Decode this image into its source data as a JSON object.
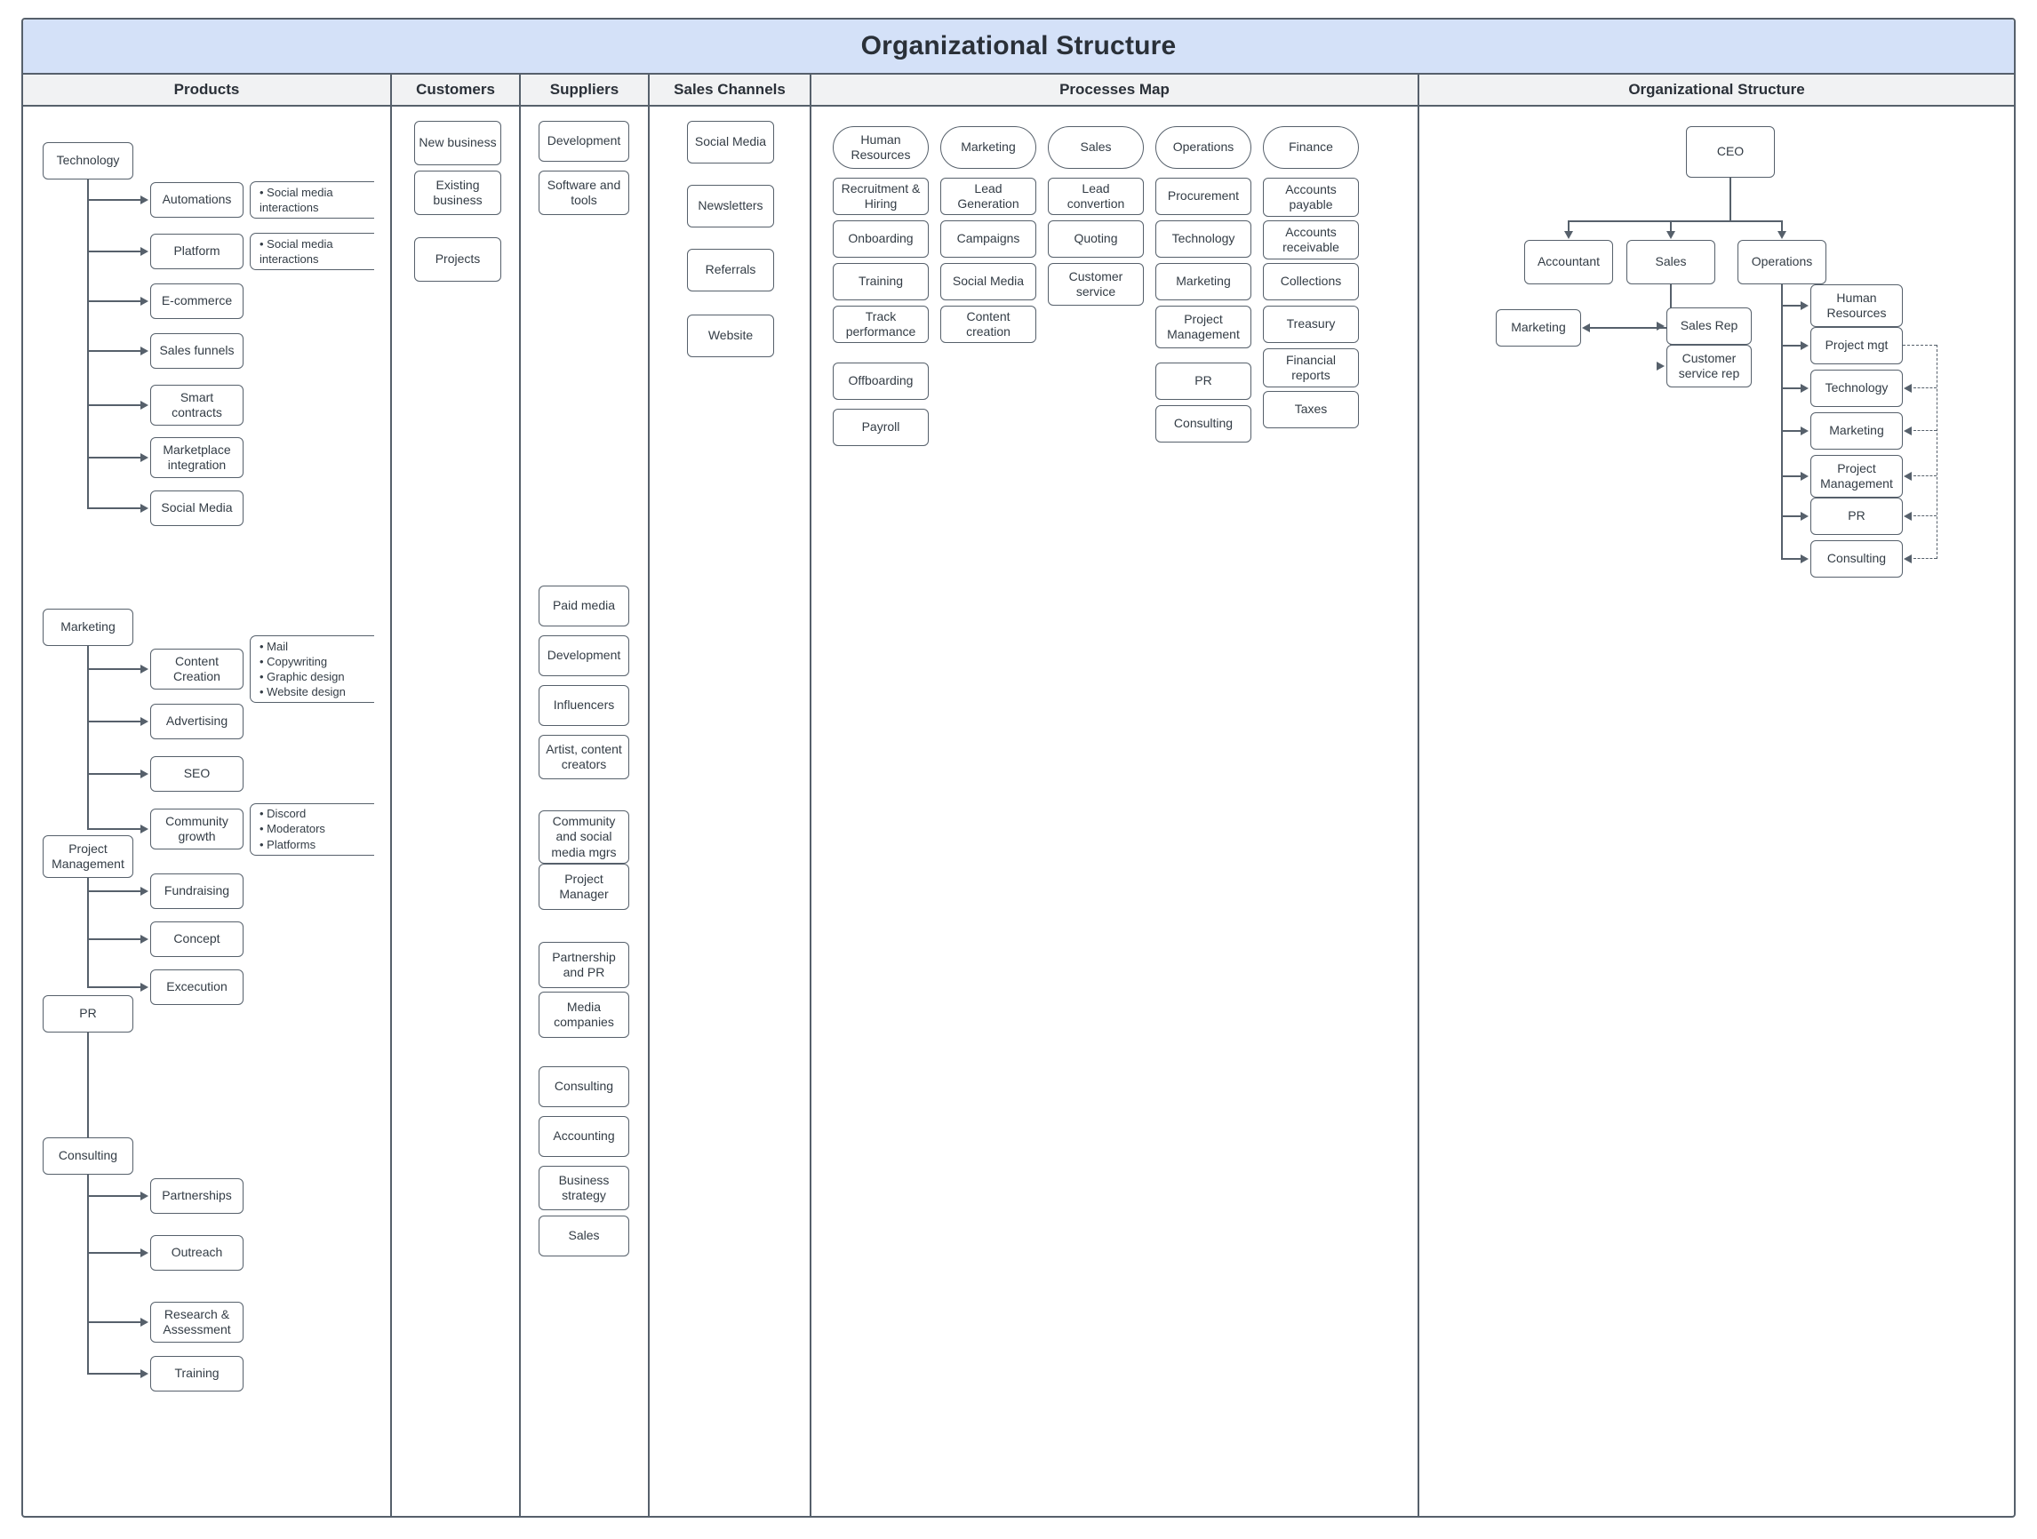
{
  "title": "Organizational Structure",
  "columns": [
    {
      "id": "products",
      "label": "Products"
    },
    {
      "id": "customers",
      "label": "Customers"
    },
    {
      "id": "suppliers",
      "label": "Suppliers"
    },
    {
      "id": "channels",
      "label": "Sales Channels"
    },
    {
      "id": "processes",
      "label": "Processes Map"
    },
    {
      "id": "org",
      "label": "Organizational Structure"
    }
  ],
  "products": {
    "groups": [
      {
        "parent": "Technology",
        "children": [
          {
            "label": "Automations",
            "notes": [
              "• Social media",
              "  interactions"
            ]
          },
          {
            "label": "Platform",
            "notes": [
              "• Social media",
              "  interactions"
            ]
          },
          {
            "label": "E-commerce"
          },
          {
            "label": "Sales funnels"
          },
          {
            "label": "Smart contracts"
          },
          {
            "label": "Marketplace integration"
          },
          {
            "label": "Social Media"
          }
        ]
      },
      {
        "parent": "Marketing",
        "children": [
          {
            "label": "Content Creation",
            "notes": [
              "• Mail",
              "• Copywriting",
              "• Graphic design",
              "• Website design"
            ]
          },
          {
            "label": "Advertising"
          },
          {
            "label": "SEO"
          },
          {
            "label": "Community growth",
            "notes": [
              "• Discord",
              "• Moderators",
              "• Platforms"
            ]
          }
        ]
      },
      {
        "parent": "Project Management",
        "children": [
          {
            "label": "Fundraising"
          },
          {
            "label": "Concept"
          },
          {
            "label": "Excecution"
          }
        ]
      },
      {
        "parent": "PR",
        "children": [
          {
            "label": "Partnerships"
          },
          {
            "label": "Outreach"
          }
        ]
      },
      {
        "parent": "Consulting",
        "children": [
          {
            "label": "Research & Assessment"
          },
          {
            "label": "Training"
          }
        ]
      }
    ]
  },
  "customers": {
    "items": [
      "New business",
      "Existing business",
      "Projects"
    ]
  },
  "suppliers": {
    "items": [
      "Development",
      "Software and tools",
      "Paid media",
      "Development",
      "Influencers",
      "Artist, content creators",
      "Community and social media mgrs",
      "Project Manager",
      "Partnership and PR",
      "Media companies",
      "Consulting",
      "Accounting",
      "Business strategy",
      "Sales"
    ]
  },
  "channels": {
    "items": [
      "Social Media",
      "Newsletters",
      "Referrals",
      "Website"
    ]
  },
  "processes": {
    "columns": [
      {
        "head": "Human Resources",
        "items": [
          "Recruitment & Hiring",
          "Onboarding",
          "Training",
          "Track performance",
          "Offboarding",
          "Payroll"
        ]
      },
      {
        "head": "Marketing",
        "items": [
          "Lead Generation",
          "Campaigns",
          "Social Media",
          "Content creation"
        ]
      },
      {
        "head": "Sales",
        "items": [
          "Lead convertion",
          "Quoting",
          "Customer service"
        ]
      },
      {
        "head": "Operations",
        "items": [
          "Procurement",
          "Technology",
          "Marketing",
          "Project Management",
          "PR",
          "Consulting"
        ]
      },
      {
        "head": "Finance",
        "items": [
          "Accounts payable",
          "Accounts receivable",
          "Collections",
          "Treasury",
          "Financial reports",
          "Taxes"
        ]
      }
    ]
  },
  "org": {
    "root": "CEO",
    "level1": [
      "Accountant",
      "Sales",
      "Operations"
    ],
    "sales_children": [
      "Marketing",
      "Sales Rep",
      "Customer service rep"
    ],
    "operations_children": [
      "Human Resources",
      "Project mgt",
      "Technology",
      "Marketing",
      "Project Management",
      "PR",
      "Consulting"
    ]
  },
  "colors": {
    "title_bg": "#d4e1f8",
    "header_bg": "#f1f2f3",
    "stroke": "#56606b",
    "text": "#333c45"
  }
}
